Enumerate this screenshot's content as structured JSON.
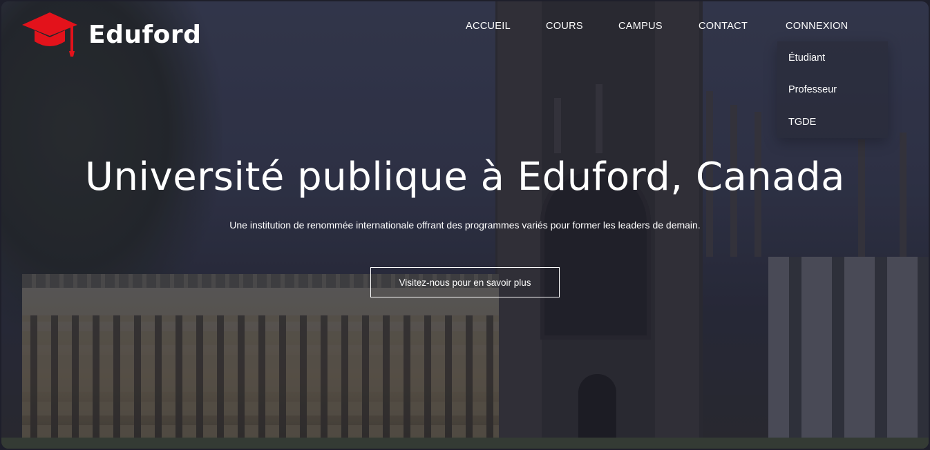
{
  "brand": {
    "name": "Eduford",
    "icon": "graduation-cap-icon",
    "icon_color": "#e3121b"
  },
  "nav": {
    "items": [
      {
        "label": "ACCUEIL"
      },
      {
        "label": "COURS"
      },
      {
        "label": "CAMPUS"
      },
      {
        "label": "CONTACT"
      },
      {
        "label": "CONNEXION"
      }
    ]
  },
  "login_dropdown": {
    "items": [
      {
        "label": "Étudiant"
      },
      {
        "label": "Professeur"
      },
      {
        "label": "TGDE"
      }
    ]
  },
  "hero": {
    "title": "Université publique à Eduford, Canada",
    "subtitle": "Une institution de renommée internationale offrant des programmes variés pour former les leaders de demain.",
    "cta_label": "Visitez-nous pour en savoir plus"
  },
  "colors": {
    "text": "#ffffff",
    "accent": "#e3121b"
  }
}
